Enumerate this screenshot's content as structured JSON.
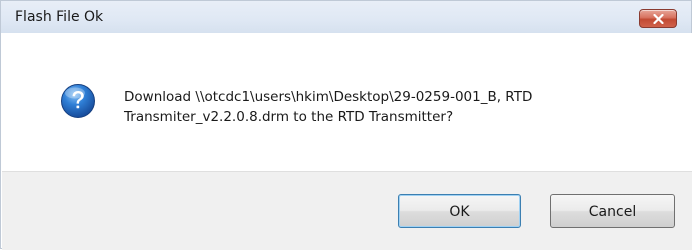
{
  "window": {
    "title": "Flash File Ok"
  },
  "message": {
    "text": "Download  \\\\otcdc1\\users\\hkim\\Desktop\\29-0259-001_B, RTD\nTransmiter_v2.2.0.8.drm  to the RTD Transmitter?"
  },
  "icons": {
    "dialog_icon": "question-icon",
    "close": "close-icon"
  },
  "buttons": {
    "ok_label": "OK",
    "cancel_label": "Cancel"
  },
  "colors": {
    "close_button": "#c24a33",
    "icon_blue": "#1f5fb4",
    "footer_bg": "#f0f0f0"
  }
}
